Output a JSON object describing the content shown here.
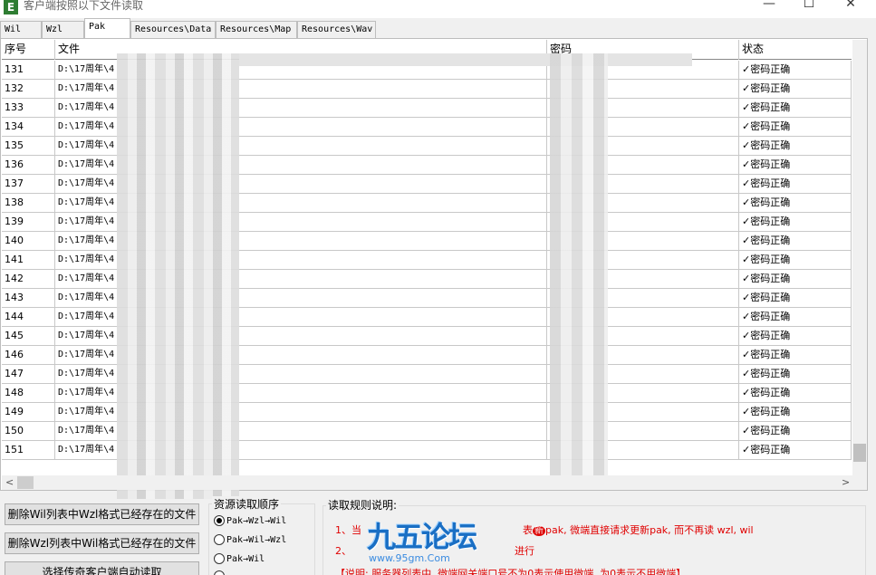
{
  "window": {
    "title": "客户端按照以下文件读取",
    "minimize": "—",
    "maximize": "☐",
    "close": "✕"
  },
  "tabs": [
    "Wil",
    "Wzl",
    "Pak",
    "Resources\\Data",
    "Resources\\Map",
    "Resources\\Wav"
  ],
  "active_tab": "Pak",
  "grid": {
    "columns": [
      "序号",
      "文件",
      "密码",
      "状态"
    ],
    "rows": [
      {
        "no": "131",
        "file": "D:\\17周年\\4",
        "status": "✓密码正确"
      },
      {
        "no": "132",
        "file": "D:\\17周年\\4",
        "status": "✓密码正确"
      },
      {
        "no": "133",
        "file": "D:\\17周年\\4",
        "status": "✓密码正确"
      },
      {
        "no": "134",
        "file": "D:\\17周年\\4",
        "status": "✓密码正确"
      },
      {
        "no": "135",
        "file": "D:\\17周年\\4",
        "status": "✓密码正确"
      },
      {
        "no": "136",
        "file": "D:\\17周年\\4",
        "status": "✓密码正确"
      },
      {
        "no": "137",
        "file": "D:\\17周年\\4",
        "status": "✓密码正确"
      },
      {
        "no": "138",
        "file": "D:\\17周年\\4",
        "status": "✓密码正确"
      },
      {
        "no": "139",
        "file": "D:\\17周年\\4",
        "status": "✓密码正确"
      },
      {
        "no": "140",
        "file": "D:\\17周年\\4",
        "status": "✓密码正确"
      },
      {
        "no": "141",
        "file": "D:\\17周年\\4",
        "status": "✓密码正确"
      },
      {
        "no": "142",
        "file": "D:\\17周年\\4",
        "status": "✓密码正确"
      },
      {
        "no": "143",
        "file": "D:\\17周年\\4",
        "status": "✓密码正确"
      },
      {
        "no": "144",
        "file": "D:\\17周年\\4",
        "status": "✓密码正确"
      },
      {
        "no": "145",
        "file": "D:\\17周年\\4",
        "status": "✓密码正确"
      },
      {
        "no": "146",
        "file": "D:\\17周年\\4",
        "status": "✓密码正确"
      },
      {
        "no": "147",
        "file": "D:\\17周年\\4",
        "status": "✓密码正确"
      },
      {
        "no": "148",
        "file": "D:\\17周年\\4",
        "status": "✓密码正确"
      },
      {
        "no": "149",
        "file": "D:\\17周年\\4",
        "status": "✓密码正确"
      },
      {
        "no": "150",
        "file": "D:\\17周年\\4",
        "status": "✓密码正确"
      },
      {
        "no": "151",
        "file": "D:\\17周年\\4",
        "status": "✓密码正确"
      }
    ]
  },
  "scroll": {
    "left_arrow": "<",
    "right_arrow": ">"
  },
  "buttons": {
    "delete_wil": "删除Wil列表中Wzl格式已经存在的文件",
    "delete_wzl": "删除Wzl列表中Wil格式已经存在的文件",
    "auto_read": "选择传奇客户端自动读取"
  },
  "order_group": {
    "title": "资源读取顺序",
    "options": [
      "Pak→Wzl→Wil",
      "Pak→Wil→Wzl",
      "Pak→Wil"
    ],
    "selected": 0
  },
  "rules": {
    "title": "读取规则说明:",
    "line1_a": "1、当",
    "line1_b": "表",
    "line1_c": "pak, 微端直接请求更新pak, 而不再读 wzl, wil",
    "line2_a": "2、",
    "line2_b": "进行",
    "note": "【说明: 服务器列表中, 微端网关端口号不为0表示使用微端, 为0表示不用微端】"
  },
  "watermark": {
    "text": "九五论坛",
    "url": "www.95gm.Com"
  },
  "colors": {
    "rule_text": "#e00000",
    "watermark": "#1a6fc4"
  }
}
